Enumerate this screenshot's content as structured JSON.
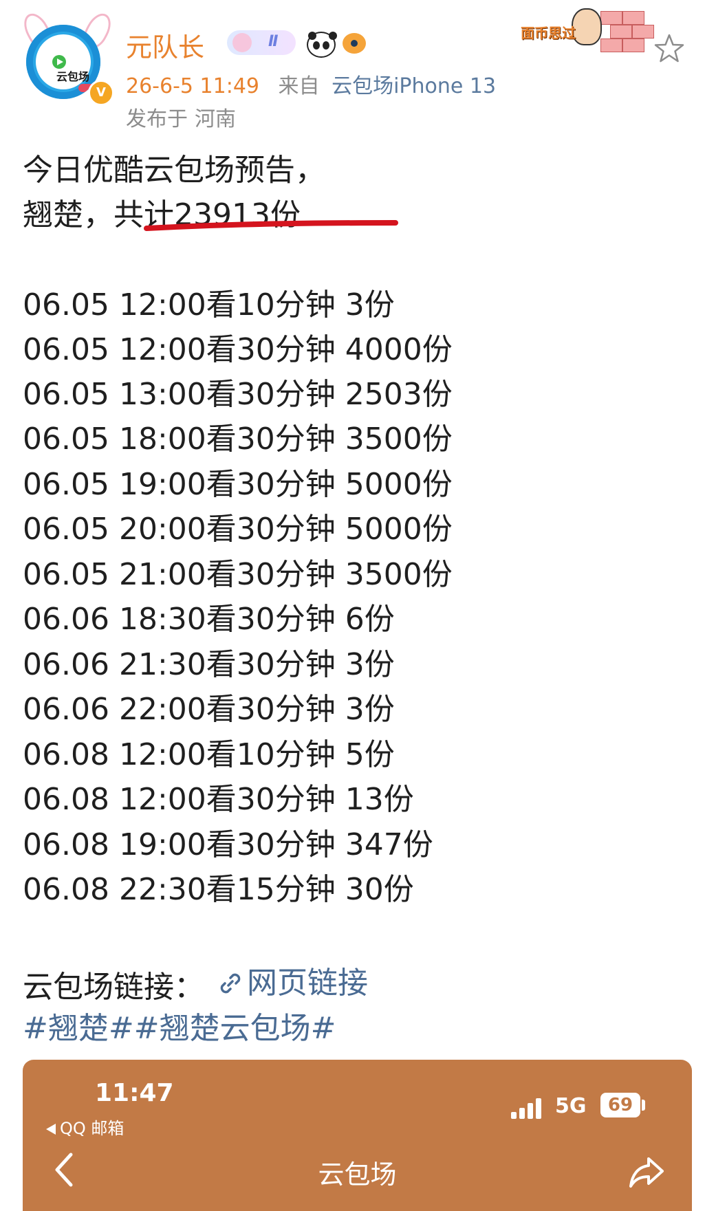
{
  "header": {
    "username": "元队长",
    "rank_badge": "Ⅱ",
    "post_time": "26-6-5 11:49",
    "source_label": "来自",
    "source": "云包场iPhone 13",
    "location_label": "发布于",
    "location": "河南",
    "avatar_text": "云包场",
    "verified_mark": "V",
    "decoration_text": "面币思过",
    "icons": [
      "avatar",
      "verified-badge",
      "panda-icon",
      "fish-icon",
      "star-icon"
    ]
  },
  "post": {
    "intro_line1": "今日优酷云包场预告，",
    "intro_line2_prefix": "翘楚，",
    "intro_line2_total": "共计23913份",
    "schedule": [
      "06.05 12:00看10分钟 3份",
      "06.05 12:00看30分钟 4000份",
      "06.05 13:00看30分钟 2503份",
      "06.05 18:00看30分钟 3500份",
      "06.05 19:00看30分钟 5000份",
      "06.05 20:00看30分钟 5000份",
      "06.05 21:00看30分钟 3500份",
      "06.06 18:30看30分钟 6份",
      "06.06 21:30看30分钟 3份",
      "06.06 22:00看30分钟 3份",
      "06.08 12:00看10分钟 5份",
      "06.08 12:00看30分钟 13份",
      "06.08 19:00看30分钟 347份",
      "06.08 22:30看15分钟 30份"
    ],
    "link_label": "云包场链接：",
    "link_text": "网页链接",
    "hashtag1": "#翘楚#",
    "hashtag2": "#翘楚云包场#"
  },
  "embed": {
    "time": "11:47",
    "back_app": "QQ 邮箱",
    "network": "5G",
    "battery": "69",
    "title": "云包场"
  },
  "colors": {
    "username": "#e8822e",
    "link": "#4a6b93",
    "underline": "#d4141e",
    "embed_bg": "#c27a46"
  }
}
